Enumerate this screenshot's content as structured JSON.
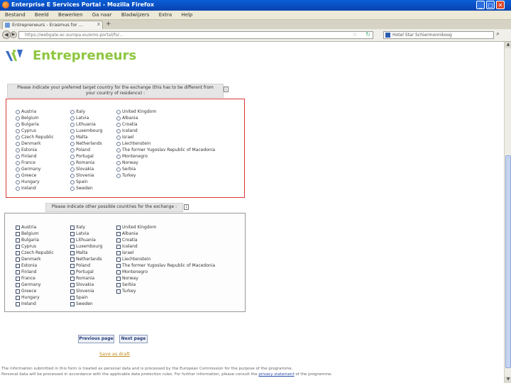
{
  "window": {
    "title": "Enterprise E Services Portal - Mozilla Firefox"
  },
  "menu": [
    "Bestand",
    "Beeld",
    "Bewerken",
    "Ga naar",
    "Bladwijzers",
    "Extra",
    "Help"
  ],
  "tab": {
    "label": "Entrepreneurs - Erasmus for ...",
    "close": "x",
    "new": "+"
  },
  "nav": {
    "url": "https://webgate.ec.europa.eu/ems-portal/fo/...",
    "search": "Hotel Star Schiermonnikoog"
  },
  "brand": "Entrepreneurs",
  "q1": {
    "label_line1": "Please indicate your preferred target country for the exchange (this has to be different from",
    "label_line2": "your country of residence) :",
    "help": "i"
  },
  "q2": {
    "label": "Please indicate other possible countries for the exchange :",
    "help": "i"
  },
  "countries": {
    "col1": [
      "Austria",
      "Belgium",
      "Bulgaria",
      "Cyprus",
      "Czech Republic",
      "Denmark",
      "Estonia",
      "Finland",
      "France",
      "Germany",
      "Greece",
      "Hungary",
      "Ireland"
    ],
    "col2": [
      "Italy",
      "Latvia",
      "Lithuania",
      "Luxembourg",
      "Malta",
      "Netherlands",
      "Poland",
      "Portugal",
      "Romania",
      "Slovakia",
      "Slovenia",
      "Spain",
      "Sweden"
    ],
    "col3": [
      "United Kingdom",
      "Albania",
      "Croatia",
      "Iceland",
      "Israel",
      "Liechtenstein",
      "The former Yugoslav Republic of Macedonia",
      "Montenegro",
      "Norway",
      "Serbia",
      "Turkey"
    ]
  },
  "buttons": {
    "previous": "Previous page",
    "next": "Next page"
  },
  "save": "Save as draft",
  "footer": {
    "line1": "The information submitted in this form is treated as personal data and is processed by the European Commission for the purpose of the programme.",
    "line2": "Personal data will be processed in accordance with the applicable data protection rules. For further information, please consult the ",
    "privacy": "privacy statement",
    "line2_end": " of the programme."
  },
  "colors": {
    "brand": "#8ec63f",
    "highlight": "#d93838",
    "titlebar": "#0a5fd8"
  }
}
